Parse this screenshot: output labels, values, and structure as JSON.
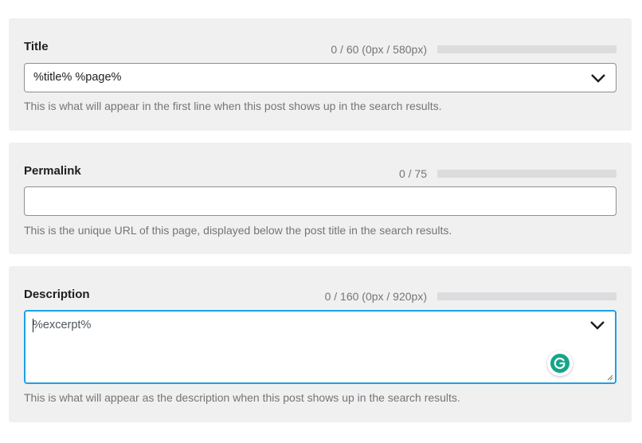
{
  "sections": {
    "title": {
      "label": "Title",
      "counter": "0 / 60 (0px / 580px)",
      "value": "%title% %page%",
      "help": "This is what will appear in the first line when this post shows up in the search results."
    },
    "permalink": {
      "label": "Permalink",
      "counter": "0 / 75",
      "value": "",
      "help": "This is the unique URL of this page, displayed below the post title in the search results."
    },
    "description": {
      "label": "Description",
      "counter": "0 / 160 (0px / 920px)",
      "value": "%excerpt%",
      "help": "This is what will appear as the description when this post shows up in the search results."
    }
  },
  "colors": {
    "panel_bg": "#f0f0f1",
    "focus_border": "#1ea1e3",
    "grammarly": "#15a588"
  },
  "icons": [
    "chevron-down-icon",
    "grammarly-icon",
    "resize-handle-icon"
  ]
}
